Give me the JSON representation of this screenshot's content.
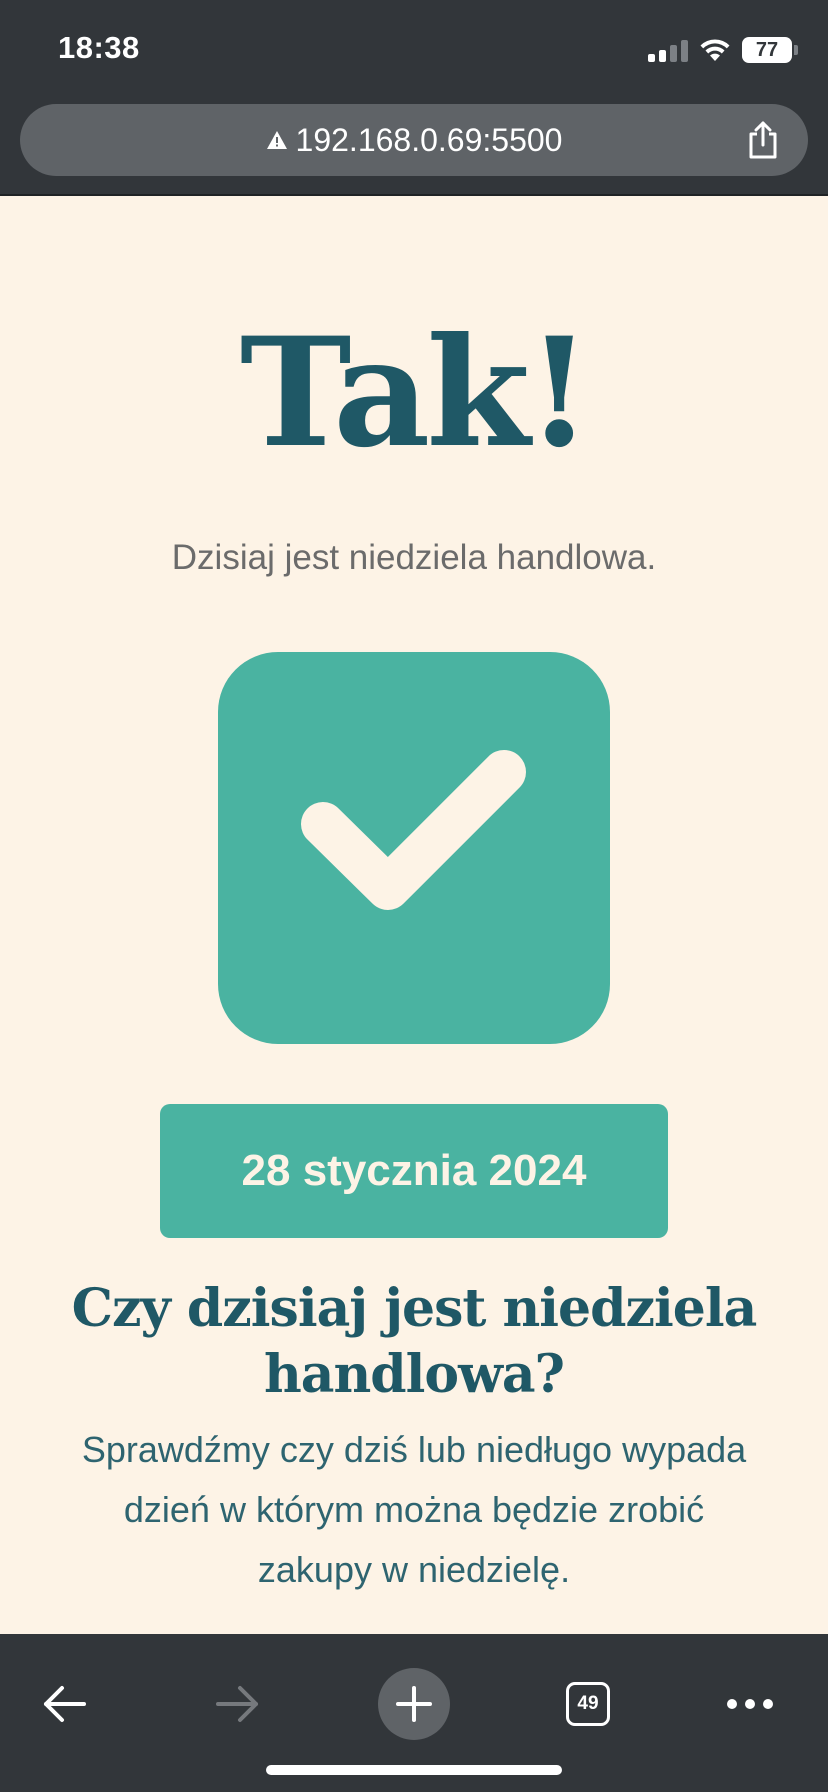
{
  "status_bar": {
    "time": "18:38",
    "battery": "77"
  },
  "address_bar": {
    "url": "192.168.0.69:5500",
    "warning_icon": "warning-icon",
    "share_icon": "share-icon"
  },
  "page": {
    "hero_title": "Tak!",
    "hero_subtitle": "Dzisiaj jest niedziela handlowa.",
    "check_icon": "check-icon",
    "date": "28 stycznia 2024",
    "question_title": "Czy dzisiaj jest niedziela handlowa?",
    "description": "Sprawdźmy czy dziś lub niedługo wypada dzień w którym można będzie zrobić zakupy w niedzielę."
  },
  "toolbar": {
    "back_icon": "back-arrow-icon",
    "forward_icon": "forward-arrow-icon",
    "new_tab_icon": "plus-icon",
    "tabs_count": "49",
    "menu_icon": "more-dots-icon"
  },
  "colors": {
    "background": "#FDF3E6",
    "accent": "#4AB3A1",
    "heading": "#1F5866",
    "chrome": "#32363A"
  }
}
